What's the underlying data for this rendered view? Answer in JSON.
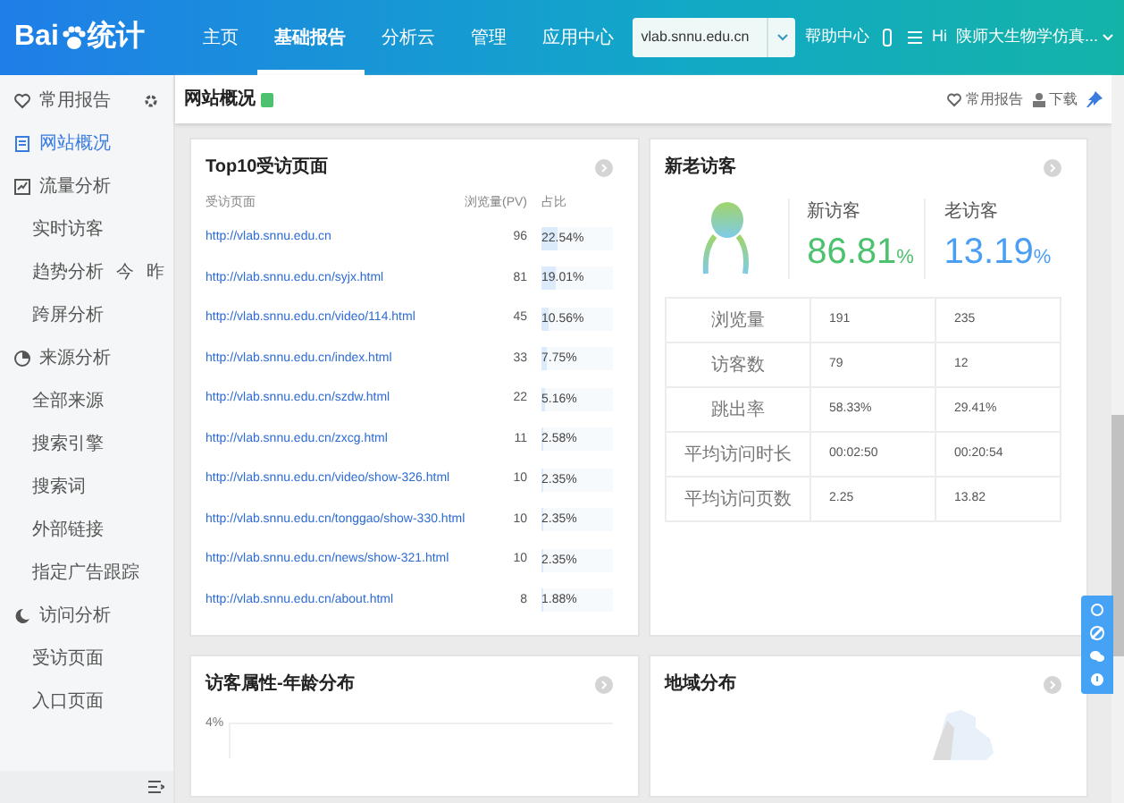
{
  "logo": {
    "prefix": "Bai",
    "suffix": "统计"
  },
  "nav": [
    {
      "label": "主页",
      "selected": false
    },
    {
      "label": "基础报告",
      "selected": true
    },
    {
      "label": "分析云",
      "selected": false
    },
    {
      "label": "管理",
      "selected": false
    },
    {
      "label": "应用中心",
      "selected": false
    }
  ],
  "site_selector": {
    "value": "vlab.snnu.edu.cn"
  },
  "help": "帮助中心",
  "user": "Hi  陕师大生物学仿真...",
  "sidebar": {
    "items": [
      {
        "kind": "top",
        "label": "常用报告",
        "selected": false
      },
      {
        "kind": "top",
        "label": "网站概况",
        "selected": true
      },
      {
        "kind": "section",
        "label": "流量分析",
        "children": [
          {
            "label": "实时访客",
            "selected": false
          },
          {
            "label": "趋势分析",
            "extras": [
              "今",
              "昨"
            ],
            "selected": false
          },
          {
            "label": "跨屏分析",
            "selected": false
          }
        ]
      },
      {
        "kind": "section",
        "label": "来源分析",
        "children": [
          {
            "label": "全部来源",
            "selected": false
          },
          {
            "label": "搜索引擎",
            "selected": false
          },
          {
            "label": "搜索词",
            "selected": false
          },
          {
            "label": "外部链接",
            "selected": false
          },
          {
            "label": "指定广告跟踪",
            "selected": false
          }
        ]
      },
      {
        "kind": "section",
        "label": "访问分析",
        "children": [
          {
            "label": "受访页面",
            "selected": false
          },
          {
            "label": "入口页面",
            "selected": false
          }
        ]
      }
    ]
  },
  "page_header": {
    "title": "网站概况",
    "actions": [
      "常用报告",
      "下载"
    ]
  },
  "top_pages": {
    "title": "Top10受访页面",
    "columns": [
      "受访页面",
      "浏览量(PV)",
      "占比"
    ],
    "rows": [
      {
        "url": "http://vlab.snnu.edu.cn",
        "pv": "96",
        "share": "22.54%",
        "level": 0.2254
      },
      {
        "url": "http://vlab.snnu.edu.cn/syjx.html",
        "pv": "81",
        "share": "19.01%",
        "level": 0.1901
      },
      {
        "url": "http://vlab.snnu.edu.cn/video/114.html",
        "pv": "45",
        "share": "10.56%",
        "level": 0.1056
      },
      {
        "url": "http://vlab.snnu.edu.cn/index.html",
        "pv": "33",
        "share": "7.75%",
        "level": 0.0775
      },
      {
        "url": "http://vlab.snnu.edu.cn/szdw.html",
        "pv": "22",
        "share": "5.16%",
        "level": 0.0516
      },
      {
        "url": "http://vlab.snnu.edu.cn/zxcg.html",
        "pv": "11",
        "share": "2.58%",
        "level": 0.0258
      },
      {
        "url": "http://vlab.snnu.edu.cn/video/show-326.html",
        "pv": "10",
        "share": "2.35%",
        "level": 0.0235
      },
      {
        "url": "http://vlab.snnu.edu.cn/tonggao/show-330.html",
        "pv": "10",
        "share": "2.35%",
        "level": 0.0235
      },
      {
        "url": "http://vlab.snnu.edu.cn/news/show-321.html",
        "pv": "10",
        "share": "2.35%",
        "level": 0.0235
      },
      {
        "url": "http://vlab.snnu.edu.cn/about.html",
        "pv": "8",
        "share": "1.88%",
        "level": 0.0188
      }
    ]
  },
  "visitors": {
    "title": "新老访客",
    "groups": [
      {
        "label": "新访客",
        "value": "86.81",
        "unit": "%",
        "color": "#4cc26e"
      },
      {
        "label": "老访客",
        "value": "13.19",
        "unit": "%",
        "color": "#4a9ff5"
      }
    ],
    "rows": [
      {
        "label": "浏览量",
        "new": "191",
        "old": "235"
      },
      {
        "label": "访客数",
        "new": "79",
        "old": "12"
      },
      {
        "label": "跳出率",
        "new": "58.33%",
        "old": "29.41%"
      },
      {
        "label": "平均访问时长",
        "new": "00:02:50",
        "old": "00:20:54"
      },
      {
        "label": "平均访问页数",
        "new": "2.25",
        "old": "13.82"
      }
    ]
  },
  "age": {
    "title": "访客属性-年龄分布",
    "tick_label": "4%"
  },
  "region": {
    "title": "地域分布"
  }
}
